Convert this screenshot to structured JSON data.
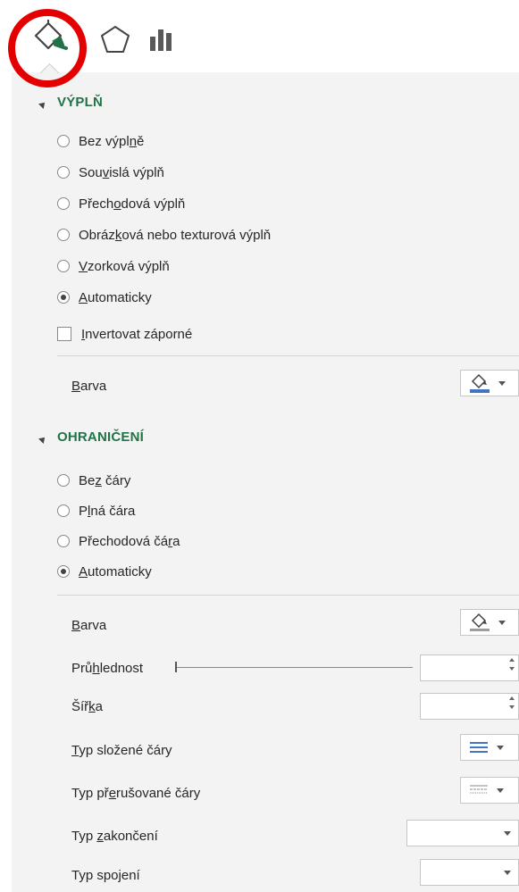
{
  "tabs": [
    {
      "name": "fill-line",
      "icon": "paint-bucket-icon"
    },
    {
      "name": "effects",
      "icon": "pentagon-icon"
    },
    {
      "name": "series-options",
      "icon": "bar-chart-icon"
    }
  ],
  "fill": {
    "title": "VÝPLŇ",
    "options": [
      {
        "label": "Bez výplně",
        "checked": false
      },
      {
        "label": "Souvislá výplň",
        "checked": false
      },
      {
        "label": "Přechodová výplň",
        "checked": false
      },
      {
        "label": "Obrázková nebo texturová výplň",
        "checked": false
      },
      {
        "label": "Vzorková výplň",
        "checked": false
      },
      {
        "label": "Automaticky",
        "checked": true
      }
    ],
    "invert_label": "Invertovat záporné",
    "color_label": "Barva"
  },
  "border": {
    "title": "OHRANIČENÍ",
    "options": [
      {
        "label": "Bez čáry",
        "checked": false
      },
      {
        "label": "Plná čára",
        "checked": false
      },
      {
        "label": "Přechodová čára",
        "checked": false
      },
      {
        "label": "Automaticky",
        "checked": true
      }
    ],
    "color_label": "Barva",
    "transparency_label": "Průhlednost",
    "width_label": "Šířka",
    "compound_label": "Typ složené čáry",
    "dash_label": "Typ přerušované čáry",
    "cap_label": "Typ zakončení",
    "join_label": "Typ spojení"
  },
  "colors": {
    "accent": "#217346",
    "highlight": "#e40000",
    "panel": "#f3f3f3"
  }
}
